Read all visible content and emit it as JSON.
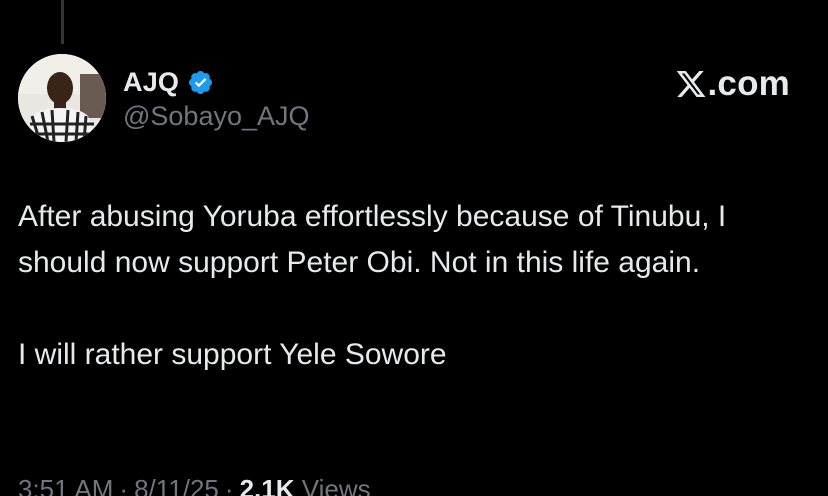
{
  "author": {
    "display_name": "AJQ",
    "handle": "@Sobayo_AJQ",
    "verified_icon": "verified-badge-icon"
  },
  "brand": {
    "logo_icon": "x-logo-icon",
    "text": ".com"
  },
  "tweet": {
    "paragraph_1": "After abusing Yoruba effortlessly because of Tinubu, I should now support Peter Obi. Not in this life again.",
    "paragraph_2": "I will rather support Yele Sowore"
  },
  "meta": {
    "time": "3:51 AM",
    "separator": "·",
    "date": "8/11/25",
    "views_count": "2.1K",
    "views_label": "Views"
  },
  "colors": {
    "background": "#000000",
    "primary_text": "#e7e9ea",
    "secondary_text": "#71767b",
    "verified_blue": "#1d9bf0"
  }
}
